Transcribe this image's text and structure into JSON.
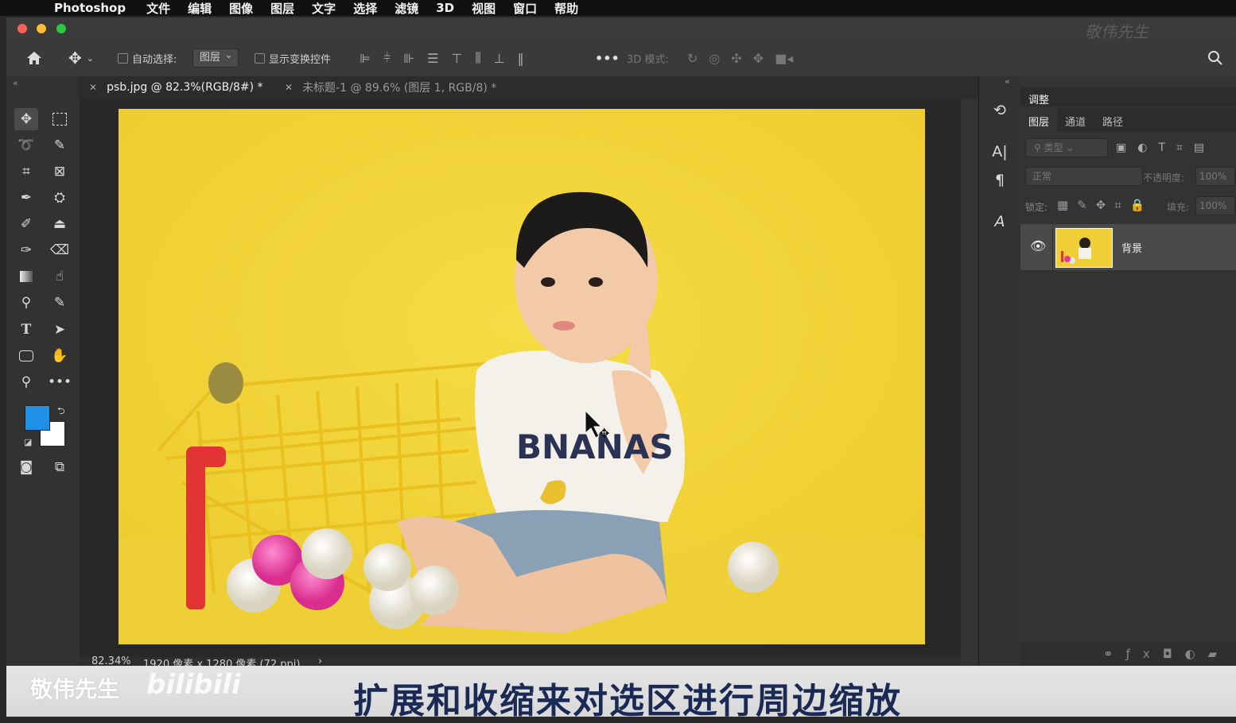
{
  "menubar": {
    "app": "Photoshop",
    "items": [
      "文件",
      "编辑",
      "图像",
      "图层",
      "文字",
      "选择",
      "滤镜",
      "3D",
      "视图",
      "窗口",
      "帮助"
    ]
  },
  "watermark_top": "敬伟先生",
  "options_bar": {
    "auto_select_label": "自动选择:",
    "auto_select_value": "图层",
    "show_transform_label": "显示变换控件",
    "more": "•••",
    "mode_3d_label": "3D 模式:"
  },
  "tabs": [
    {
      "label": "psb.jpg @ 82.3%(RGB/8#) *",
      "active": true
    },
    {
      "label": "未标题-1 @ 89.6% (图层 1, RGB/8) *",
      "active": false
    }
  ],
  "status": {
    "zoom": "82.34%",
    "doc_info": "1920 像素 x 1280 像素 (72 ppi)",
    "arrow": "›"
  },
  "colors": {
    "foreground": "#1e90e6",
    "background": "#ffffff",
    "accent": "#f2d33b"
  },
  "panel": {
    "adjust_tab": "调整",
    "tabs": [
      "图层",
      "通道",
      "路径"
    ],
    "filter_placeholder": "类型",
    "blend_mode": "正常",
    "opacity_label": "不透明度:",
    "opacity_value": "100%",
    "lock_label": "锁定:",
    "fill_label": "填充:",
    "fill_value": "100%"
  },
  "layer": {
    "name": "背景"
  },
  "subtitle": {
    "text": "扩展和收缩来对选区进行周边缩放",
    "brand": "敬伟先生"
  }
}
